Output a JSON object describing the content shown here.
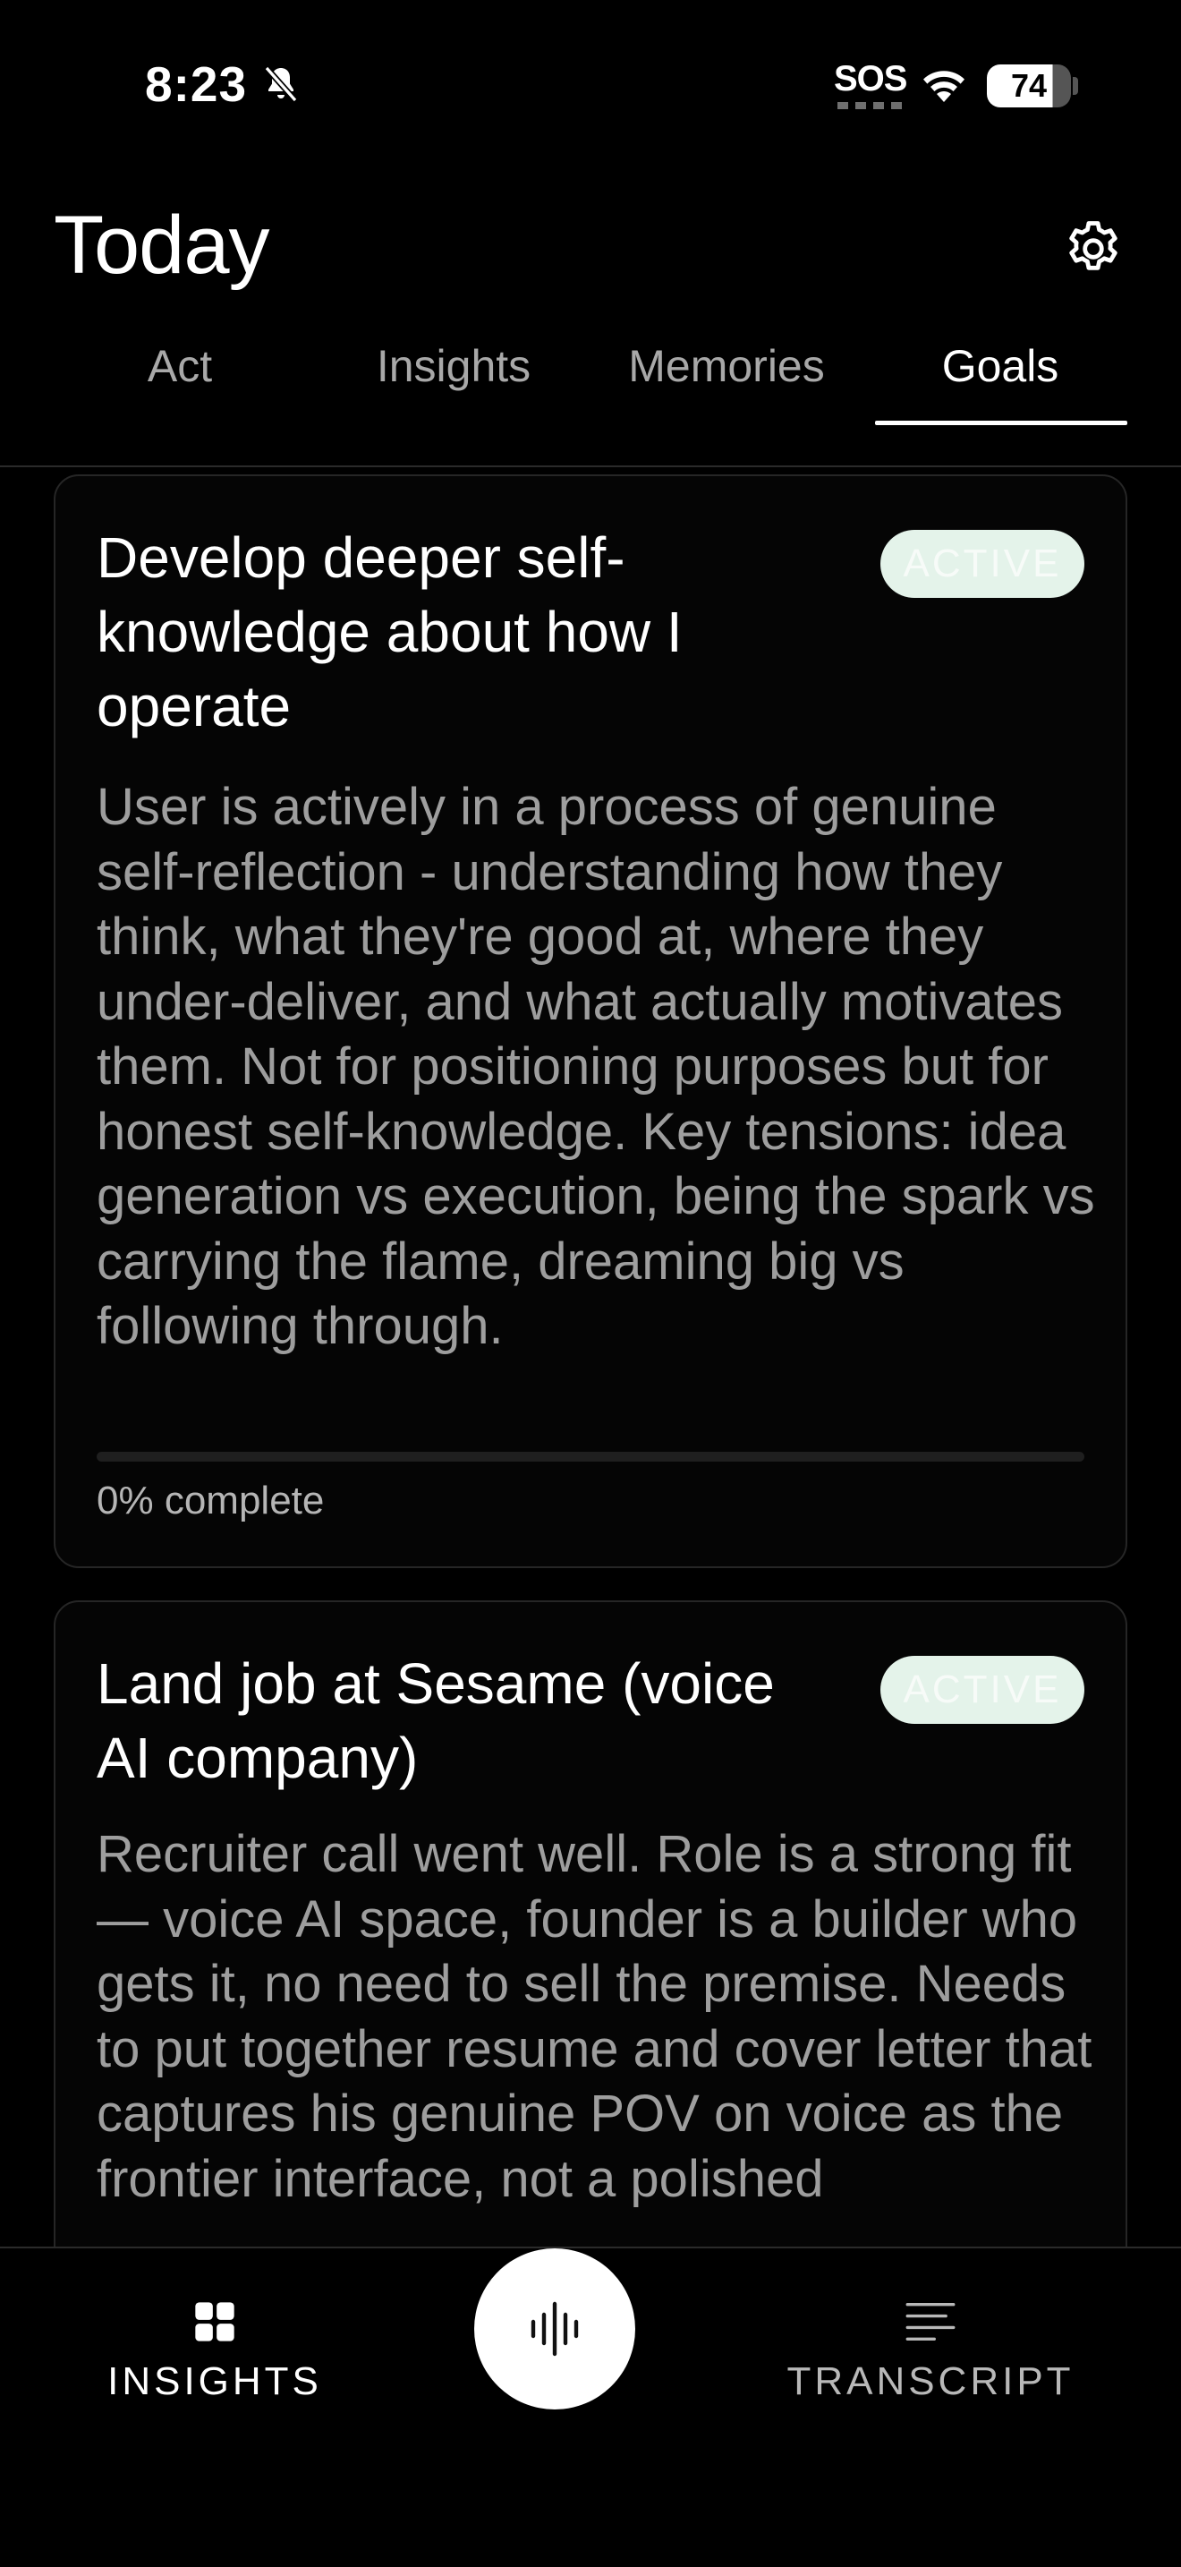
{
  "status_bar": {
    "time": "8:23",
    "sos": "SOS",
    "battery": "74",
    "icons": [
      "bell-muted-icon",
      "wifi-icon",
      "battery-icon"
    ]
  },
  "header": {
    "title": "Today",
    "settings_icon": "gear-icon"
  },
  "tabs": [
    {
      "label": "Act",
      "active": false
    },
    {
      "label": "Insights",
      "active": false
    },
    {
      "label": "Memories",
      "active": false
    },
    {
      "label": "Goals",
      "active": true
    }
  ],
  "goals": [
    {
      "title": "Develop deeper self-knowledge about how I operate",
      "status": "ACTIVE",
      "description": "User is actively in a process of genuine self-reflection - understanding how they think, what they're good at, where they under-deliver, and what actually motivates them. Not for positioning purposes but for honest self-knowledge. Key tensions: idea generation vs execution, being the spark vs carrying the flame, dreaming big vs following through.",
      "progress": 0,
      "progress_label": "0% complete"
    },
    {
      "title": "Land job at Sesame (voice AI company)",
      "status": "ACTIVE",
      "description": "Recruiter call went well. Role is a strong fit — voice AI space, founder is a builder who gets it, no need to sell the premise. Needs to put together resume and cover letter that captures his genuine POV on voice as the frontier interface, not a polished"
    }
  ],
  "bottom_nav": {
    "insights_label": "INSIGHTS",
    "transcript_label": "TRANSCRIPT",
    "record_icon": "waveform-icon"
  },
  "colors": {
    "background": "#000000",
    "badge": "#e4f3ea",
    "description_text": "#9e9e9e",
    "card_border": "#262626"
  }
}
